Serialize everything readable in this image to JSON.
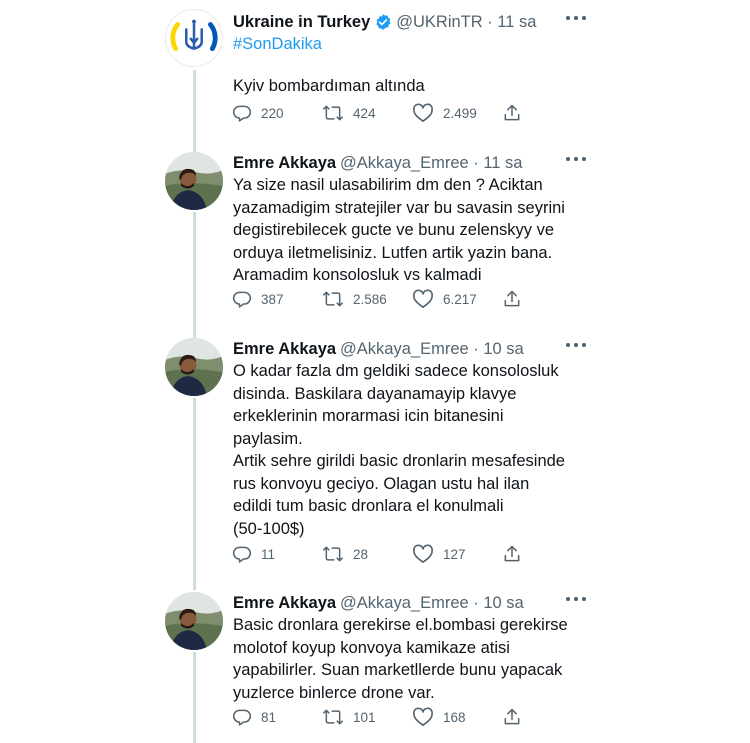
{
  "tweets": [
    {
      "name": "Ukraine in Turkey",
      "verified": true,
      "handle_time": "@UKRinTR · 11 sa",
      "hashtag": "#SonDakika",
      "text": "Kyiv bombardıman altında",
      "replies": "220",
      "retweets": "424",
      "likes": "2.499"
    },
    {
      "name": "Emre Akkaya",
      "handle_time": "@Akkaya_Emree · 11 sa",
      "text": "Ya size nasil ulasabilirim dm den ? Aciktan\nyazamadigim stratejiler var bu savasin seyrini\ndegistirebilecek gucte ve bunu zelenskyy ve\norduya iletmelisiniz. Lutfen artik yazin bana.\nAramadim konsolosluk vs kalmadi",
      "replies": "387",
      "retweets": "2.586",
      "likes": "6.217"
    },
    {
      "name": "Emre Akkaya",
      "handle_time": "@Akkaya_Emree · 10 sa",
      "text": "O kadar fazla dm geldiki sadece konsolosluk\ndisinda. Baskilara dayanamayip klavye\nerkeklerinin morarmasi icin bitanesini\npaylasim.\nArtik sehre girildi basic dronlarin mesafesinde\nrus konvoyu geciyo. Olagan ustu hal ilan\nedildi tum basic dronlara el konulmali\n(50-100$)",
      "replies": "11",
      "retweets": "28",
      "likes": "127"
    },
    {
      "name": "Emre Akkaya",
      "handle_time": "@Akkaya_Emree · 10 sa",
      "text": "Basic dronlara gerekirse el.bombasi gerekirse\nmolotof koyup konvoya kamikaze atisi\nyapabilirler. Suan marketllerde bunu yapacak\nyuzlerce binlerce drone var.",
      "replies": "81",
      "retweets": "101",
      "likes": "168"
    }
  ],
  "icons": {
    "reply": "reply-icon",
    "retweet": "retweet-icon",
    "like": "heart-icon",
    "share": "share-icon",
    "more": "more-icon",
    "verified": "verified-badge-icon"
  },
  "colors": {
    "text": "#0f1419",
    "secondary": "#536471",
    "accent": "#1d9bf0",
    "thread_line": "#cfd9de"
  }
}
